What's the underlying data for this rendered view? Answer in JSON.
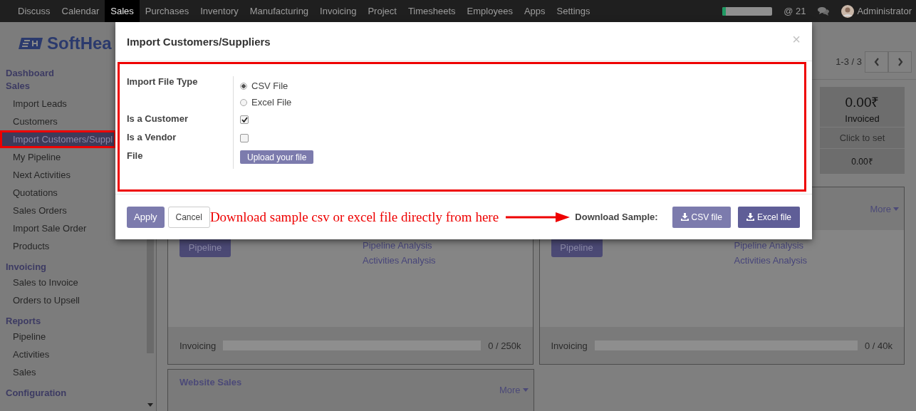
{
  "top_nav": {
    "items": [
      {
        "label": "Discuss",
        "selected": false
      },
      {
        "label": "Calendar",
        "selected": false
      },
      {
        "label": "Sales",
        "selected": true
      },
      {
        "label": "Purchases",
        "selected": false
      },
      {
        "label": "Inventory",
        "selected": false
      },
      {
        "label": "Manufacturing",
        "selected": false
      },
      {
        "label": "Invoicing",
        "selected": false
      },
      {
        "label": "Project",
        "selected": false
      },
      {
        "label": "Timesheets",
        "selected": false
      },
      {
        "label": "Employees",
        "selected": false
      },
      {
        "label": "Apps",
        "selected": false
      },
      {
        "label": "Settings",
        "selected": false
      }
    ],
    "progress": {
      "level": 0.07
    },
    "mentions": {
      "symbol": "@",
      "count": "21"
    },
    "user": "Administrator"
  },
  "logo": "SoftHea",
  "sidebar": {
    "sections": [
      {
        "title": "Dashboard"
      },
      {
        "title": "Sales",
        "items": [
          {
            "label": "Import Leads",
            "selected": false
          },
          {
            "label": "Customers",
            "selected": false
          },
          {
            "label": "Import Customers/Suppl",
            "selected": true
          },
          {
            "label": "My Pipeline",
            "selected": false
          },
          {
            "label": "Next Activities",
            "selected": false
          },
          {
            "label": "Quotations",
            "selected": false
          },
          {
            "label": "Sales Orders",
            "selected": false
          },
          {
            "label": "Import Sale Order",
            "selected": false
          },
          {
            "label": "Products",
            "selected": false
          }
        ]
      },
      {
        "title": "Invoicing",
        "items": [
          {
            "label": "Sales to Invoice",
            "selected": false
          },
          {
            "label": "Orders to Upsell",
            "selected": false
          }
        ]
      },
      {
        "title": "Reports",
        "items": [
          {
            "label": "Pipeline",
            "selected": false
          },
          {
            "label": "Activities",
            "selected": false
          },
          {
            "label": "Sales",
            "selected": false
          }
        ]
      },
      {
        "title": "Configuration"
      }
    ]
  },
  "pager": "1-3 / 3",
  "stats": {
    "amount": "0.00₹",
    "label": "Invoiced",
    "target": "Click to set",
    "total": "0.00₹"
  },
  "cards": [
    {
      "button": "Pipeline",
      "links": [
        "Pipeline Analysis",
        "Activities Analysis"
      ],
      "footer_label": "Invoicing",
      "level": 0,
      "footer_value": "0 / 250k"
    },
    {
      "more": "More",
      "button": "Pipeline",
      "links": [
        "Pipeline Analysis",
        "Activities Analysis"
      ],
      "footer_label": "Invoicing",
      "level": 0,
      "footer_value": "0 / 40k"
    }
  ],
  "website_card": {
    "title": "Website Sales",
    "more": "More"
  },
  "dialog": {
    "title": "Import Customers/Suppliers",
    "close": "×",
    "file_type": {
      "label": "Import File Type",
      "options": [
        {
          "label": "CSV File",
          "selected": true
        },
        {
          "label": "Excel File",
          "selected": false
        }
      ]
    },
    "checks": [
      {
        "label": "Is a Customer",
        "checked": true
      },
      {
        "label": "Is a Vendor",
        "checked": false
      }
    ],
    "file": {
      "label": "File",
      "button": "Upload your file"
    },
    "apply": "Apply",
    "cancel": "Cancel",
    "annotation": "Download sample csv or excel file directly from here",
    "download_label": "Download Sample:",
    "downloads": [
      {
        "label": "CSV file",
        "kind": "light"
      },
      {
        "label": "Excel file",
        "kind": "dark"
      }
    ]
  }
}
